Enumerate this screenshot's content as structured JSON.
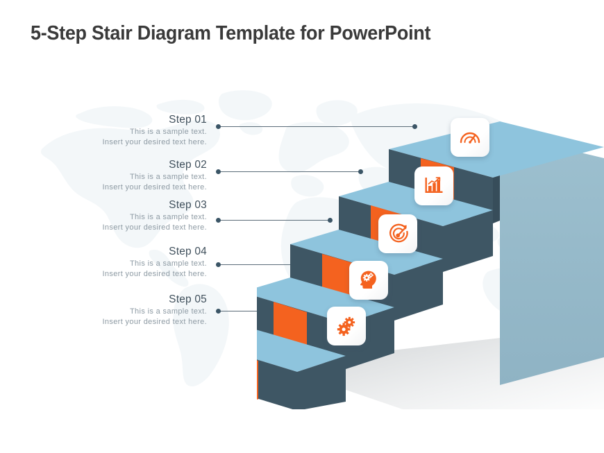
{
  "slide": {
    "title": "5-Step Stair Diagram Template for PowerPoint",
    "background_color": "#ffffff",
    "watermark": "world-map"
  },
  "theme": {
    "orange": "#f4621f",
    "dark_slate": "#3e5664",
    "dark_slate_shade": "#374d5a",
    "light_blue_tread": "#8ec4dd",
    "side_face": "#93b8c9",
    "side_face_light": "#a3c4d2",
    "title_color": "#3a3a3a",
    "step_title_color": "#40505c",
    "step_desc_color": "#8d9aa3",
    "connector_color": "#5a6b78",
    "map_color": "#e8eff3"
  },
  "steps": [
    {
      "label": "Step 01",
      "desc_line1": "This is a sample  text.",
      "desc_line2": "Insert your desired text here.",
      "icon": "gauge-icon"
    },
    {
      "label": "Step 02",
      "desc_line1": "This is a sample  text.",
      "desc_line2": "Insert your desired text here.",
      "icon": "bar-chart-growth-icon"
    },
    {
      "label": "Step 03",
      "desc_line1": "This is a sample  text.",
      "desc_line2": "Insert your desired text here.",
      "icon": "target-arrow-icon"
    },
    {
      "label": "Step 04",
      "desc_line1": "This is a sample  text.",
      "desc_line2": "Insert your desired text here.",
      "icon": "head-gears-icon"
    },
    {
      "label": "Step 05",
      "desc_line1": "This is a sample  text.",
      "desc_line2": "Insert your desired text here.",
      "icon": "gears-icon"
    }
  ]
}
